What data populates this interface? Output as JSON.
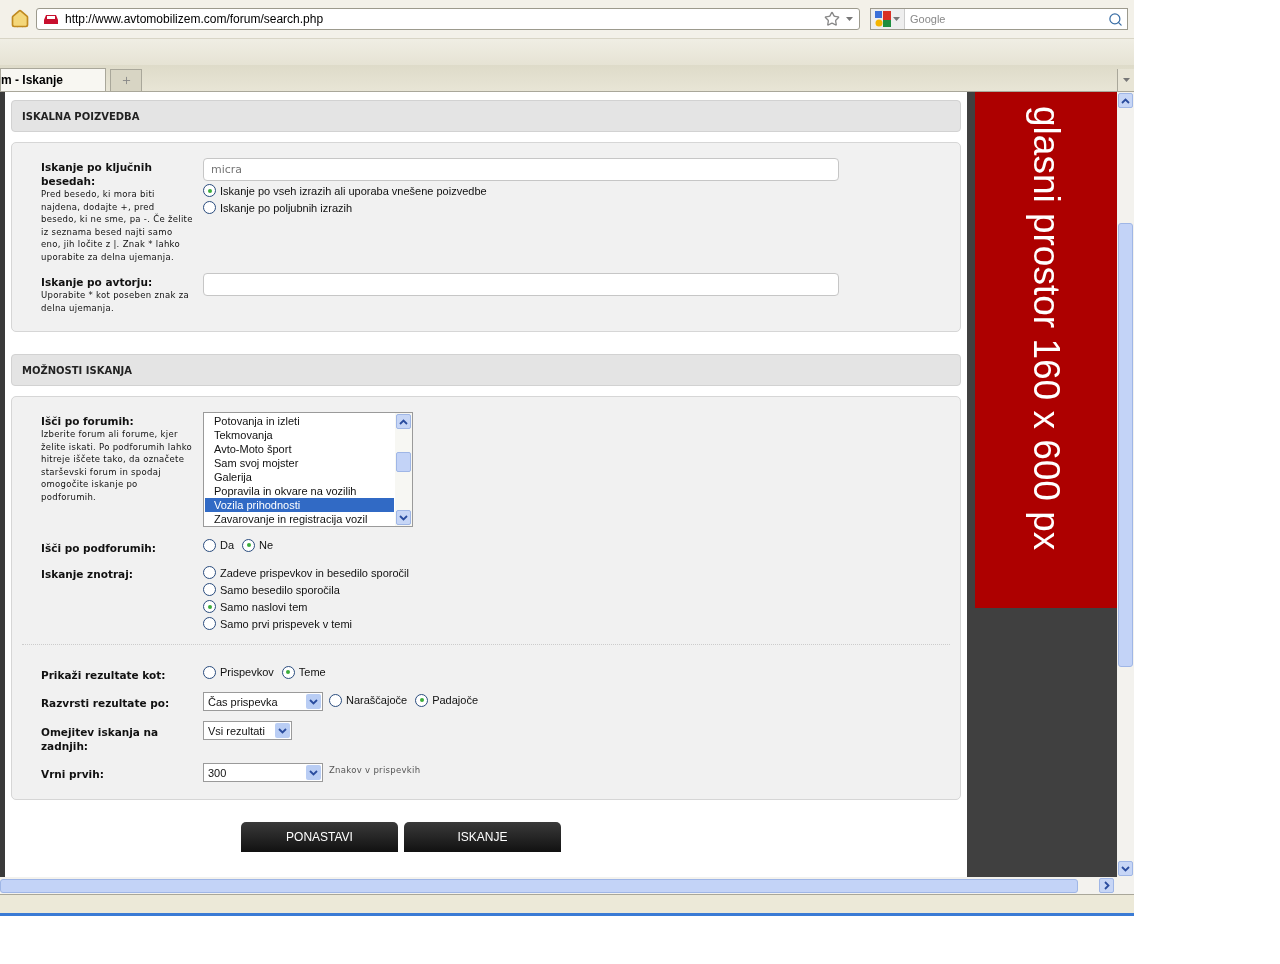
{
  "browser": {
    "url": "http://www.avtomobilizem.com/forum/search.php",
    "search_placeholder": "Google",
    "tabs": [
      {
        "label": "m - Iskanje",
        "selected": true
      }
    ]
  },
  "sections": [
    {
      "title": "ISKALNA POIZVEDBA",
      "groups": [
        {
          "rows": [
            {
              "label": "Iskanje po ključnih besedah:",
              "help": "Pred besedo, ki mora biti najdena, dodajte +, pred besedo, ki ne sme, pa -. Če želite iz seznama besed najti samo eno, jih ločite z |. Znak * lahko uporabite za delna ujemanja.",
              "controls": [
                {
                  "kind": "text",
                  "placeholder": "micra"
                },
                {
                  "kind": "radios",
                  "inline": false,
                  "options": [
                    {
                      "label": "Iskanje po vseh izrazih ali uporaba vnešene poizvedbe",
                      "selected": true
                    },
                    {
                      "label": "Iskanje po poljubnih izrazih",
                      "selected": false
                    }
                  ]
                }
              ]
            },
            {
              "label": "Iskanje po avtorju:",
              "help": "Uporabite * kot poseben znak za delna ujemanja.",
              "controls": [
                {
                  "kind": "text"
                }
              ]
            }
          ]
        }
      ]
    },
    {
      "title": "MOŽNOSTI ISKANJA",
      "groups": [
        {
          "rows": [
            {
              "label": "Išči po forumih:",
              "help": "Izberite forum ali forume, kjer želite iskati. Po podforumih lahko hitreje iščete tako, da označete starševski forum in spodaj omogočite iskanje po podforumih.",
              "controls": [
                {
                  "kind": "listbox",
                  "items": [
                    {
                      "label": "Potovanja in izleti",
                      "selected": false
                    },
                    {
                      "label": "Tekmovanja",
                      "selected": false
                    },
                    {
                      "label": "Avto-Moto šport",
                      "selected": false
                    },
                    {
                      "label": "Sam svoj mojster",
                      "selected": false
                    },
                    {
                      "label": "Galerija",
                      "selected": false
                    },
                    {
                      "label": "Popravila in okvare na vozilih",
                      "selected": false
                    },
                    {
                      "label": "Vozila prihodnosti",
                      "selected": true
                    },
                    {
                      "label": "Zavarovanje in registracija vozil",
                      "selected": false
                    }
                  ]
                }
              ]
            },
            {
              "label": "Išči po podforumih:",
              "controls": [
                {
                  "kind": "radios",
                  "inline": true,
                  "options": [
                    {
                      "label": "Da",
                      "selected": false
                    },
                    {
                      "label": "Ne",
                      "selected": true
                    }
                  ]
                }
              ]
            },
            {
              "label": "Iskanje znotraj:",
              "controls": [
                {
                  "kind": "radios",
                  "inline": false,
                  "options": [
                    {
                      "label": "Zadeve prispevkov in besedilo sporočil",
                      "selected": false
                    },
                    {
                      "label": "Samo besedilo sporočila",
                      "selected": false
                    },
                    {
                      "label": "Samo naslovi tem",
                      "selected": true
                    },
                    {
                      "label": "Samo prvi prispevek v temi",
                      "selected": false
                    }
                  ]
                }
              ]
            }
          ]
        },
        {
          "rows": [
            {
              "label": "Prikaži rezultate kot:",
              "controls": [
                {
                  "kind": "radios",
                  "inline": true,
                  "options": [
                    {
                      "label": "Prispevkov",
                      "selected": false
                    },
                    {
                      "label": "Teme",
                      "selected": true
                    }
                  ]
                }
              ]
            },
            {
              "label": "Razvrsti rezultate po:",
              "controls": [
                {
                  "kind": "select",
                  "value": "Čas prispevka",
                  "wide": true
                },
                {
                  "kind": "radios",
                  "inline": true,
                  "options": [
                    {
                      "label": "Naraščajoče",
                      "selected": false
                    },
                    {
                      "label": "Padajoče",
                      "selected": true
                    }
                  ]
                }
              ]
            },
            {
              "label": "Omejitev iskanja na zadnjih:",
              "controls": [
                {
                  "kind": "select",
                  "value": "Vsi rezultati",
                  "wide": false
                }
              ]
            },
            {
              "label": "Vrni prvih:",
              "controls": [
                {
                  "kind": "select",
                  "value": "300",
                  "wide": true
                },
                {
                  "kind": "note",
                  "text": "Znakov v prispevkih"
                }
              ]
            }
          ]
        }
      ]
    }
  ],
  "buttons": [
    "PONASTAVI",
    "ISKANJE"
  ],
  "ad": {
    "text": "glasni prostor 160 x 600 px"
  }
}
